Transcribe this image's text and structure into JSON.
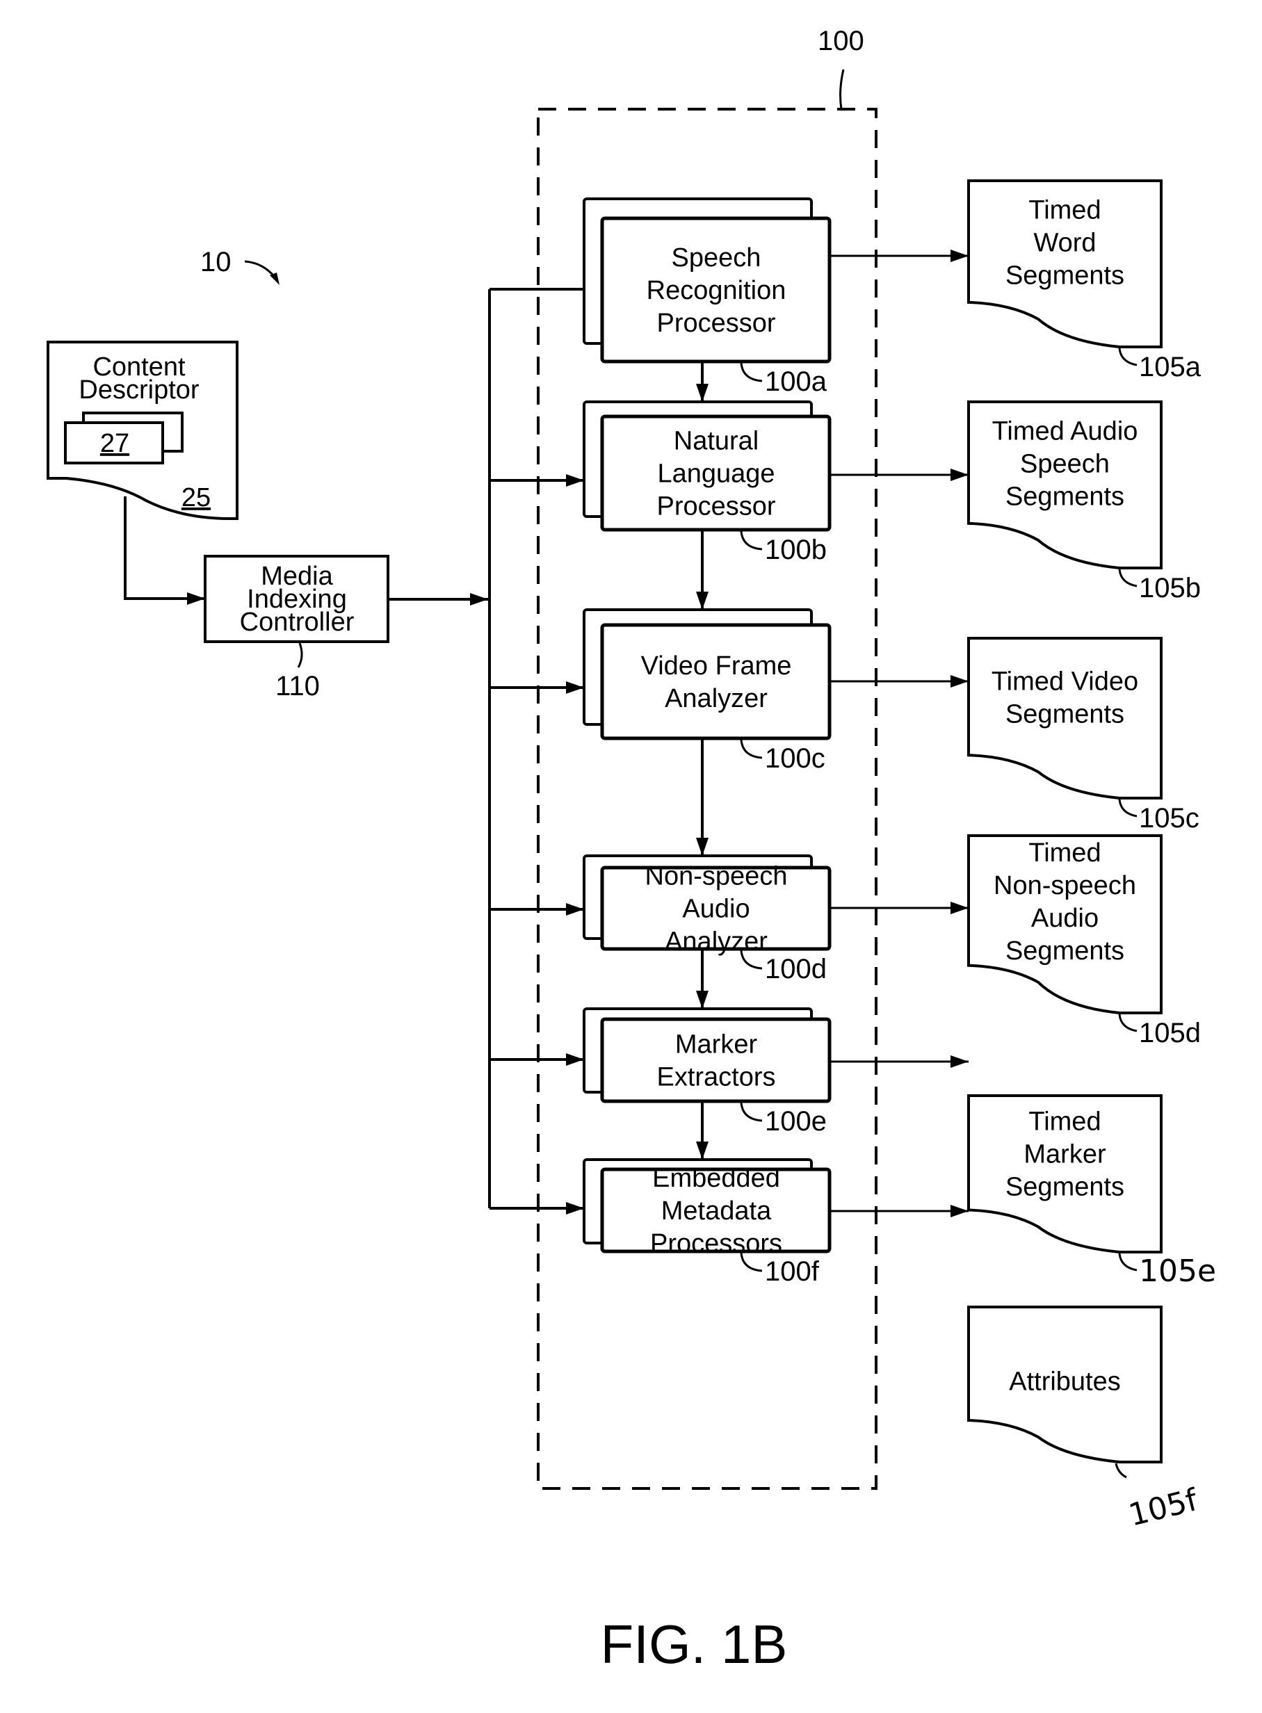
{
  "figure": {
    "label": "FIG. 1B",
    "system_ref": "10",
    "group_ref": "100"
  },
  "content_descriptor": {
    "title_lines": [
      "Content",
      "Descriptor"
    ],
    "inner_ref": "27",
    "ref": "25"
  },
  "controller": {
    "lines": [
      "Media",
      "Indexing",
      "Controller"
    ],
    "ref": "110"
  },
  "processors": [
    {
      "lines": [
        "Speech",
        "Recognition",
        "Processor"
      ],
      "ref": "100a"
    },
    {
      "lines": [
        "Natural",
        "Language",
        "Processor"
      ],
      "ref": "100b"
    },
    {
      "lines": [
        "Video Frame",
        "Analyzer"
      ],
      "ref": "100c"
    },
    {
      "lines": [
        "Non-speech",
        "Audio",
        "Analyzer"
      ],
      "ref": "100d"
    },
    {
      "lines": [
        "Marker",
        "Extractors"
      ],
      "ref": "100e"
    },
    {
      "lines": [
        "Embedded",
        "Metadata",
        "Processors"
      ],
      "ref": "100f"
    }
  ],
  "outputs": [
    {
      "lines": [
        "Timed",
        "Word",
        "Segments"
      ],
      "ref": "105a"
    },
    {
      "lines": [
        "Timed Audio",
        "Speech",
        "Segments"
      ],
      "ref": "105b"
    },
    {
      "lines": [
        "Timed Video",
        "Segments"
      ],
      "ref": "105c"
    },
    {
      "lines": [
        "Timed",
        "Non-speech",
        "Audio",
        "Segments"
      ],
      "ref": "105d"
    },
    {
      "lines": [
        "Timed",
        "Marker",
        "Segments"
      ],
      "ref": "105e"
    },
    {
      "lines": [
        "Attributes"
      ],
      "ref": "105f"
    }
  ]
}
